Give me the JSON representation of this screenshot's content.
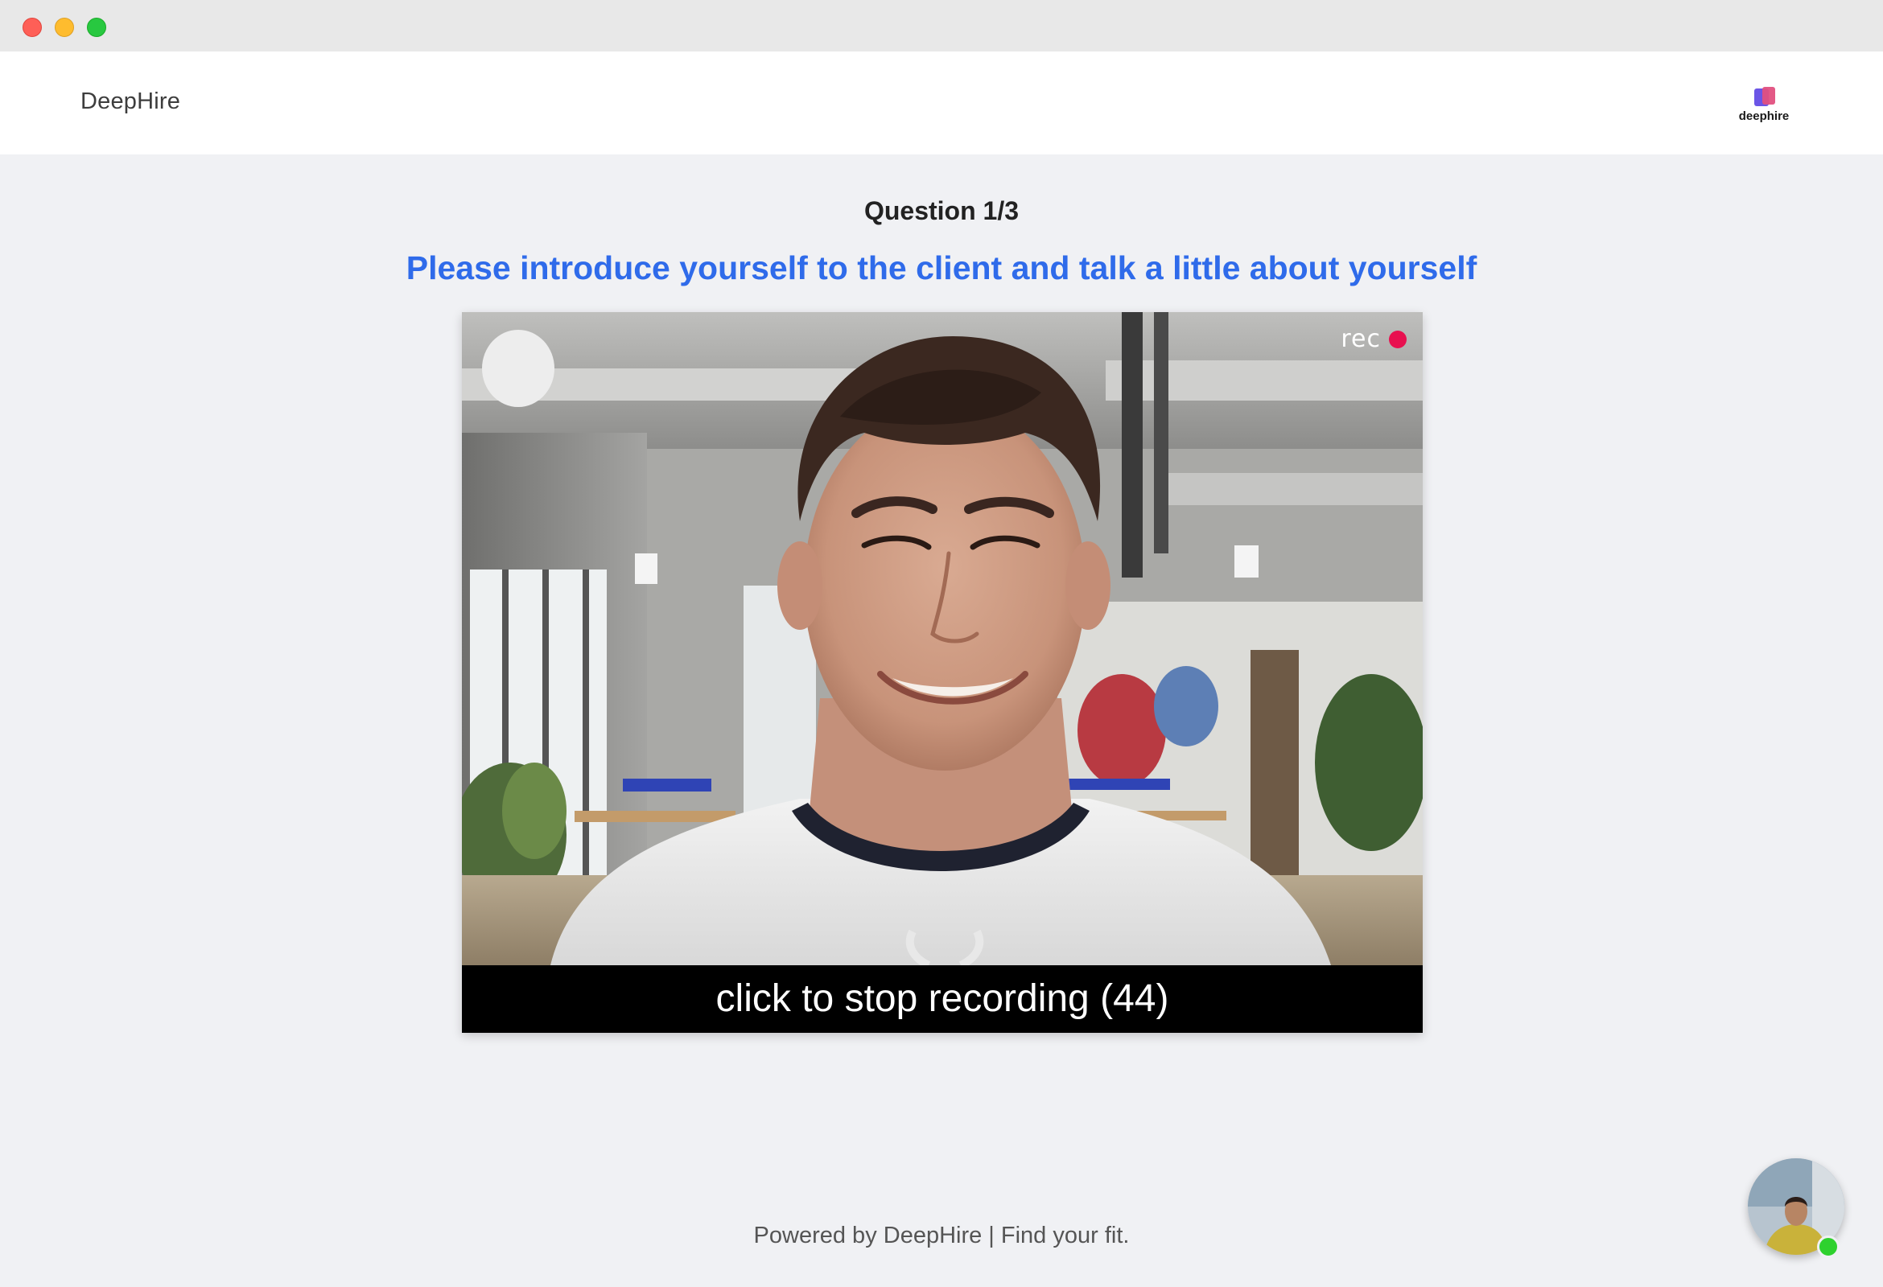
{
  "window": {
    "controls": [
      "close",
      "minimize",
      "maximize"
    ]
  },
  "header": {
    "brand": "DeepHire",
    "logo_text": "deephire"
  },
  "interview": {
    "counter": "Question 1/3",
    "question": "Please introduce yourself to the client and talk a little about yourself",
    "rec_label": "rec",
    "stop_label": "click to stop recording (44)"
  },
  "footer": {
    "text": "Powered by DeepHire | Find your fit."
  },
  "colors": {
    "accent": "#2f6bea",
    "rec": "#e8104f",
    "online": "#2ed12e"
  }
}
